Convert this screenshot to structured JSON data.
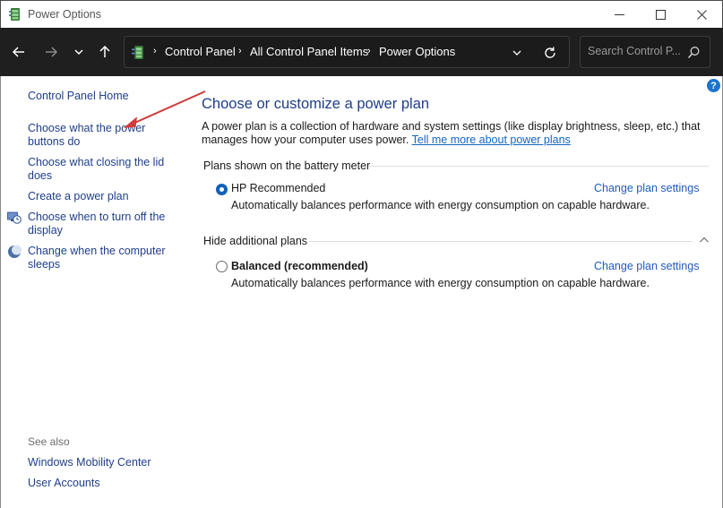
{
  "window": {
    "title": "Power Options",
    "controls": {
      "minimize": "minimize",
      "maximize": "maximize",
      "close": "close"
    }
  },
  "navbar": {
    "breadcrumb": [
      "Control Panel",
      "All Control Panel Items",
      "Power Options"
    ],
    "search_placeholder": "Search Control P..."
  },
  "sidebar": {
    "home": "Control Panel Home",
    "links": [
      {
        "label": "Choose what the power buttons do",
        "icon": null
      },
      {
        "label": "Choose what closing the lid does",
        "icon": null
      },
      {
        "label": "Create a power plan",
        "icon": null
      },
      {
        "label": "Choose when to turn off the display",
        "icon": "display-clock-icon"
      },
      {
        "label": "Change when the computer sleeps",
        "icon": "moon-sleep-icon"
      }
    ],
    "see_also_label": "See also",
    "see_also": [
      "Windows Mobility Center",
      "User Accounts"
    ]
  },
  "main": {
    "title": "Choose or customize a power plan",
    "description": "A power plan is a collection of hardware and system settings (like display brightness, sleep, etc.) that manages how your computer uses power.",
    "description_link": "Tell me more about power plans",
    "section_battery": "Plans shown on the battery meter",
    "section_hidden": "Hide additional plans",
    "plans": [
      {
        "name": "HP Recommended",
        "selected": true,
        "description": "Automatically balances performance with energy consumption on capable hardware.",
        "link": "Change plan settings"
      },
      {
        "name": "Balanced (recommended)",
        "selected": false,
        "description": "Automatically balances performance with energy consumption on capable hardware.",
        "link": "Change plan settings"
      }
    ]
  },
  "help": {
    "label": "?"
  },
  "colors": {
    "link": "#1f3e8a",
    "navbar_bg": "#1f1f1f",
    "accent": "#1361b8",
    "annotation_arrow": "#d13a3a"
  }
}
